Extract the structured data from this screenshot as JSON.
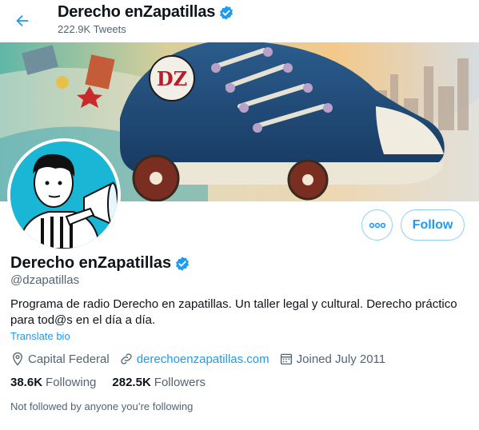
{
  "header": {
    "title": "Derecho enZapatillas",
    "tweet_count": "222.9K Tweets"
  },
  "banner": {
    "letters": "DZ"
  },
  "profile": {
    "name": "Derecho enZapatillas",
    "handle": "@dzapatillas",
    "bio": "Programa de radio Derecho en zapatillas. Un taller legal y cultural. Derecho práctico para tod@s en el día a día.",
    "translate_label": "Translate bio",
    "location": "Capital Federal",
    "website": "derechoenzapatillas.com",
    "joined": "Joined July 2011",
    "following_count": "38.6K",
    "following_label": "Following",
    "followers_count": "282.5K",
    "followers_label": "Followers",
    "followed_by_note": "Not followed by anyone you’re following"
  },
  "actions": {
    "follow_label": "Follow"
  },
  "colors": {
    "accent": "#1d9bf0",
    "secondary_text": "#536471",
    "primary_text": "#0f1419"
  }
}
